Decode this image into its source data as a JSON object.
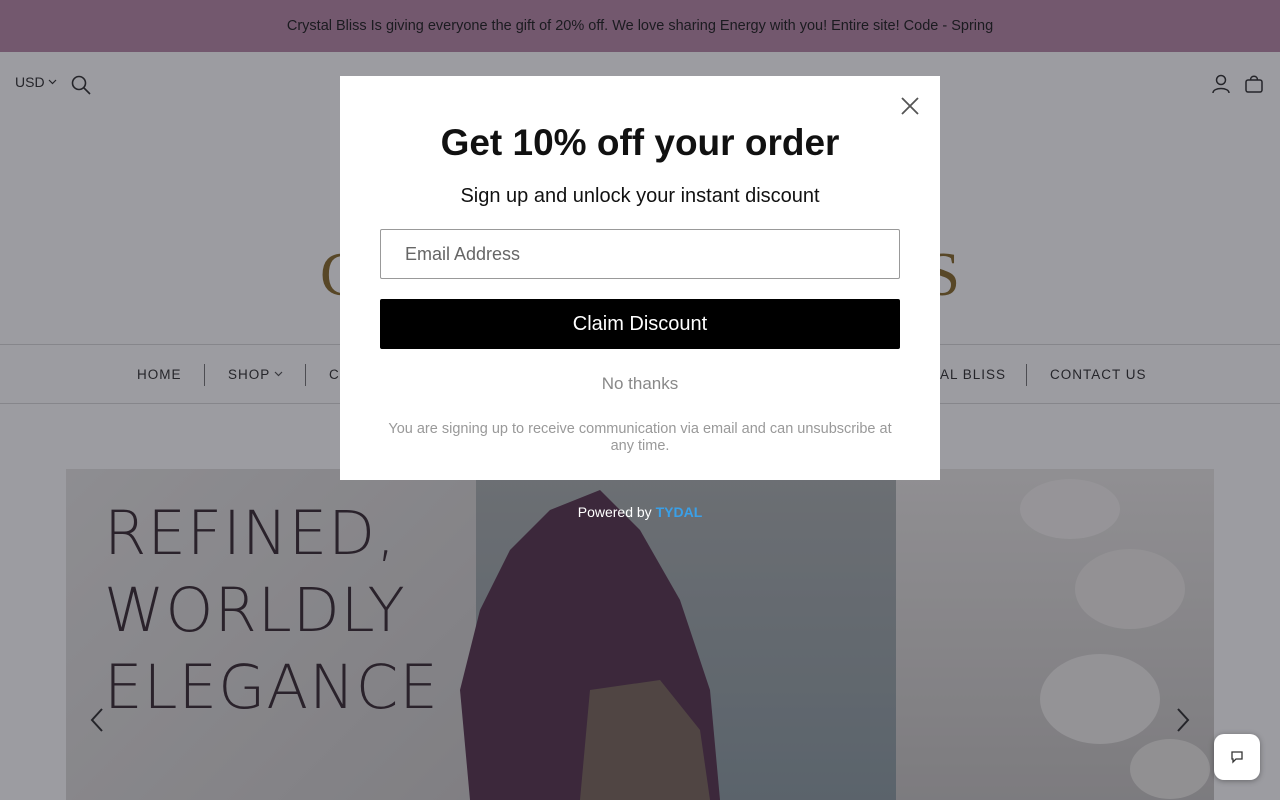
{
  "announcement": "Crystal Bliss Is giving everyone the gift of 20% off. We love sharing Energy with you! Entire site! Code - Spring",
  "header": {
    "currency": "USD",
    "logo_left": "C",
    "logo_right": "S"
  },
  "nav": {
    "home": "HOME",
    "shop": "SHOP",
    "third_partial": "C",
    "crystal_bliss_partial": "AL BLISS",
    "contact": "CONTACT US"
  },
  "hero": {
    "line1": "REFINED,",
    "line2": "WORLDLY",
    "line3": "ELEGANCE"
  },
  "popup": {
    "title": "Get 10% off your order",
    "subtitle": "Sign up and unlock your instant discount",
    "email_placeholder": "Email Address",
    "claim_button": "Claim Discount",
    "no_thanks": "No thanks",
    "legal": "You are signing up to receive communication via email and can unsubscribe at any time.",
    "powered_by": "Powered by",
    "powered_brand": "TYDAL"
  },
  "colors": {
    "announcement_bg": "#b98aa8",
    "claim_button_bg": "#000000",
    "tydal_blue": "#3aa0e8"
  }
}
